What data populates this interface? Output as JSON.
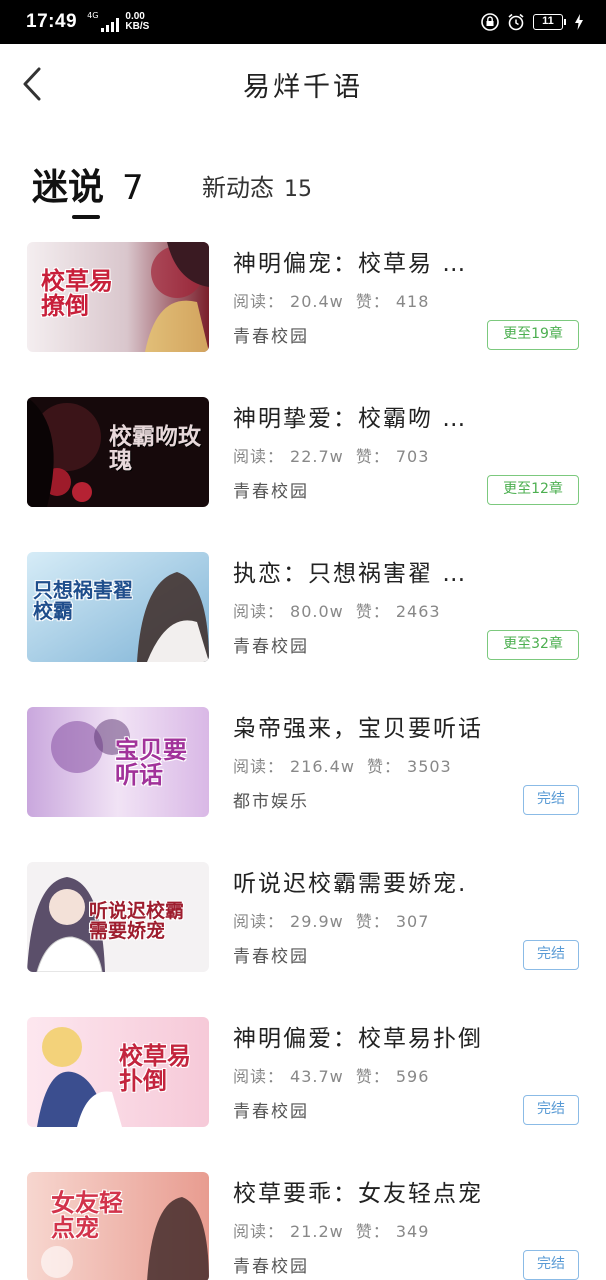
{
  "status_bar": {
    "time": "17:49",
    "network": "4G",
    "speed_value": "0.00",
    "speed_unit": "KB/S",
    "battery": "11"
  },
  "header": {
    "title": "易烊千语"
  },
  "tabs": [
    {
      "label": "迷说",
      "count": "7",
      "active": true
    },
    {
      "label": "新动态",
      "count": "15",
      "active": false
    }
  ],
  "books": [
    {
      "title": "神明偏宠：校草易 …",
      "reads_label": "阅读：",
      "reads": "20.4w",
      "likes_label": "赞：",
      "likes": "418",
      "genre": "青春校园",
      "badge": "更至19章",
      "badge_type": "update",
      "cover_text": "校草易撩倒"
    },
    {
      "title": "神明挚爱：校霸吻 …",
      "reads_label": "阅读：",
      "reads": "22.7w",
      "likes_label": "赞：",
      "likes": "703",
      "genre": "青春校园",
      "badge": "更至12章",
      "badge_type": "update",
      "cover_text": "校霸吻玫瑰"
    },
    {
      "title": "执恋：只想祸害翟 …",
      "reads_label": "阅读：",
      "reads": "80.0w",
      "likes_label": "赞：",
      "likes": "2463",
      "genre": "青春校园",
      "badge": "更至32章",
      "badge_type": "update",
      "cover_text": "只想祸害翟校霸"
    },
    {
      "title": "枭帝强来，宝贝要听话",
      "reads_label": "阅读：",
      "reads": "216.4w",
      "likes_label": "赞：",
      "likes": "3503",
      "genre": "都市娱乐",
      "badge": "完结",
      "badge_type": "done",
      "cover_text": "宝贝要听话"
    },
    {
      "title": "听说迟校霸需要娇宠.",
      "reads_label": "阅读：",
      "reads": "29.9w",
      "likes_label": "赞：",
      "likes": "307",
      "genre": "青春校园",
      "badge": "完结",
      "badge_type": "done",
      "cover_text": "听说迟校霸需要娇宠"
    },
    {
      "title": "神明偏爱：校草易扑倒",
      "reads_label": "阅读：",
      "reads": "43.7w",
      "likes_label": "赞：",
      "likes": "596",
      "genre": "青春校园",
      "badge": "完结",
      "badge_type": "done",
      "cover_text": "校草易扑倒"
    },
    {
      "title": "校草要乖：女友轻点宠",
      "reads_label": "阅读：",
      "reads": "21.2w",
      "likes_label": "赞：",
      "likes": "349",
      "genre": "青春校园",
      "badge": "完结",
      "badge_type": "done",
      "cover_text": "女友轻点宠"
    }
  ],
  "colors": {
    "update_badge": "#4caf50",
    "done_badge": "#5a9bd5",
    "cover_title": "#c81f3a"
  }
}
